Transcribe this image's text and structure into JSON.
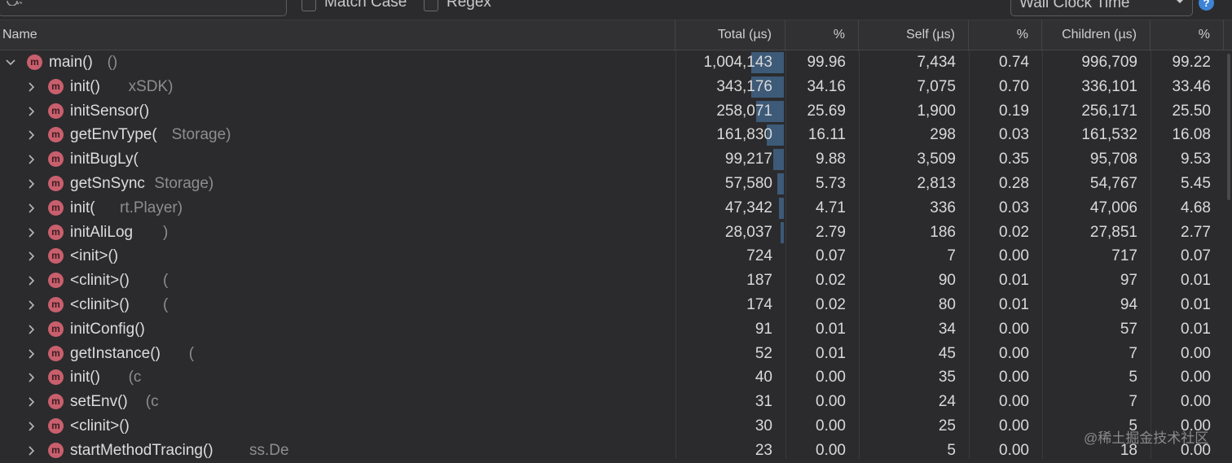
{
  "toolbar": {
    "match_case_label": "Match Case",
    "regex_label": "Regex",
    "clock_select_value": "Wall Clock Time",
    "help_symbol": "?"
  },
  "columns": {
    "name": "Name",
    "total": "Total (µs)",
    "total_pct": "%",
    "self": "Self (µs)",
    "self_pct": "%",
    "children": "Children (µs)",
    "children_pct": "%"
  },
  "badge_letter": "m",
  "rows": [
    {
      "name": "main()",
      "path": "()",
      "expanded": true,
      "total": "1,004,143",
      "total_pct": "99.96",
      "self": "7,434",
      "self_pct": "0.74",
      "children": "996,709",
      "children_pct": "99.22",
      "total_fraction": 0.9996
    },
    {
      "name": "init()",
      "path": "xSDK)",
      "total": "343,176",
      "total_pct": "34.16",
      "self": "7,075",
      "self_pct": "0.70",
      "children": "336,101",
      "children_pct": "33.46",
      "total_fraction": 0.3416
    },
    {
      "name": "initSensor()",
      "path": "",
      "total": "258,071",
      "total_pct": "25.69",
      "self": "1,900",
      "self_pct": "0.19",
      "children": "256,171",
      "children_pct": "25.50",
      "total_fraction": 0.2569
    },
    {
      "name": "getEnvType(",
      "path": "Storage)",
      "total": "161,830",
      "total_pct": "16.11",
      "self": "298",
      "self_pct": "0.03",
      "children": "161,532",
      "children_pct": "16.08",
      "total_fraction": 0.1611
    },
    {
      "name": "initBugLy(",
      "path": "",
      "total": "99,217",
      "total_pct": "9.88",
      "self": "3,509",
      "self_pct": "0.35",
      "children": "95,708",
      "children_pct": "9.53",
      "total_fraction": 0.0988
    },
    {
      "name": "getSnSync",
      "path": "Storage)",
      "total": "57,580",
      "total_pct": "5.73",
      "self": "2,813",
      "self_pct": "0.28",
      "children": "54,767",
      "children_pct": "5.45",
      "total_fraction": 0.0573
    },
    {
      "name": "init(",
      "path": "rt.Player)",
      "total": "47,342",
      "total_pct": "4.71",
      "self": "336",
      "self_pct": "0.03",
      "children": "47,006",
      "children_pct": "4.68",
      "total_fraction": 0.0471
    },
    {
      "name": "initAliLog",
      "path": ")",
      "total": "28,037",
      "total_pct": "2.79",
      "self": "186",
      "self_pct": "0.02",
      "children": "27,851",
      "children_pct": "2.77",
      "total_fraction": 0.0279
    },
    {
      "name": "<init>()",
      "path": "",
      "total": "724",
      "total_pct": "0.07",
      "self": "7",
      "self_pct": "0.00",
      "children": "717",
      "children_pct": "0.07",
      "total_fraction": 0.0007
    },
    {
      "name": "<clinit>()",
      "path": "(",
      "total": "187",
      "total_pct": "0.02",
      "self": "90",
      "self_pct": "0.01",
      "children": "97",
      "children_pct": "0.01",
      "total_fraction": 0.0002
    },
    {
      "name": "<clinit>()",
      "path": "(",
      "total": "174",
      "total_pct": "0.02",
      "self": "80",
      "self_pct": "0.01",
      "children": "94",
      "children_pct": "0.01",
      "total_fraction": 0.0002
    },
    {
      "name": "initConfig()",
      "path": "",
      "total": "91",
      "total_pct": "0.01",
      "self": "34",
      "self_pct": "0.00",
      "children": "57",
      "children_pct": "0.01",
      "total_fraction": 0.0001
    },
    {
      "name": "getInstance()",
      "path": "(",
      "total": "52",
      "total_pct": "0.01",
      "self": "45",
      "self_pct": "0.00",
      "children": "7",
      "children_pct": "0.00",
      "total_fraction": 0.0001
    },
    {
      "name": "init()",
      "path": "(c",
      "total": "40",
      "total_pct": "0.00",
      "self": "35",
      "self_pct": "0.00",
      "children": "5",
      "children_pct": "0.00",
      "total_fraction": 0.0
    },
    {
      "name": "setEnv()",
      "path": "(c",
      "total": "31",
      "total_pct": "0.00",
      "self": "24",
      "self_pct": "0.00",
      "children": "7",
      "children_pct": "0.00",
      "total_fraction": 0.0
    },
    {
      "name": "<clinit>()",
      "path": "",
      "total": "30",
      "total_pct": "0.00",
      "self": "25",
      "self_pct": "0.00",
      "children": "5",
      "children_pct": "0.00",
      "total_fraction": 0.0
    },
    {
      "name": "startMethodTracing()",
      "path": "ss.De",
      "total": "23",
      "total_pct": "0.00",
      "self": "5",
      "self_pct": "0.00",
      "children": "18",
      "children_pct": "0.00",
      "total_fraction": 0.0
    }
  ],
  "watermark": "@稀土掘金技术社区",
  "colors": {
    "background": "#2b2b2d",
    "method_badge": "#c95f6d",
    "total_bar": "#3d5a78",
    "help_icon": "#3d84d6"
  }
}
